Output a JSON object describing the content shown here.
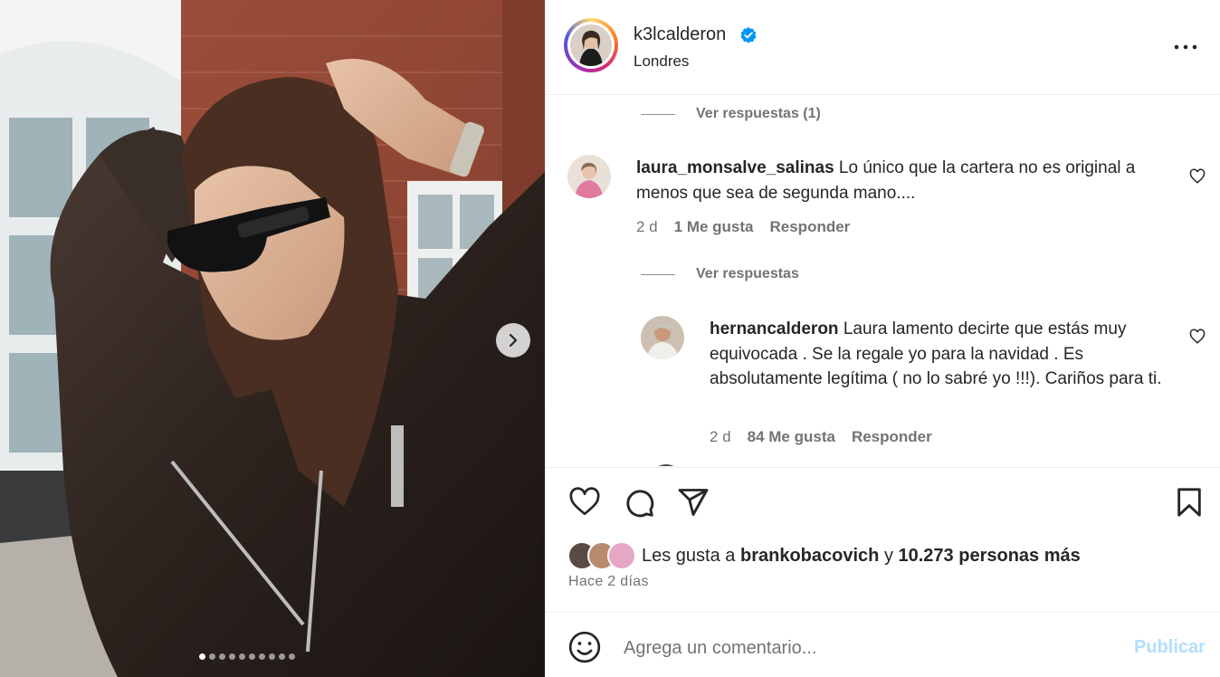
{
  "post": {
    "username": "k3lcalderon",
    "location": "Londres",
    "photo_dots_count": 10,
    "active_dot": 0
  },
  "comments": {
    "view_replies_1": "Ver respuestas (1)",
    "c1": {
      "username": "laura_monsalve_salinas",
      "text": "Lo único que la cartera no es original a menos que sea de segunda mano....",
      "time": "2 d",
      "likes": "1 Me gusta",
      "reply": "Responder"
    },
    "view_replies_2": "Ver respuestas",
    "c2": {
      "username": "hernancalderon",
      "text": "Laura lamento decirte que estás muy equivocada . Se la regale yo para la navidad . Es absolutamente legítima ( no lo sabré yo !!!). Cariños para ti.",
      "time": "2 d",
      "likes": "84 Me gusta",
      "reply": "Responder"
    }
  },
  "likes": {
    "prefix": "Les gusta a",
    "user": "brankobacovich",
    "joiner": "y",
    "others": "10.273 personas más"
  },
  "time_ago": "Hace 2 días",
  "comment_box": {
    "placeholder": "Agrega un comentario...",
    "publish_label": "Publicar"
  },
  "colors": {
    "verified": "#0095f6",
    "publish_disabled": "#b2dffc",
    "secondary_text": "#737373"
  }
}
